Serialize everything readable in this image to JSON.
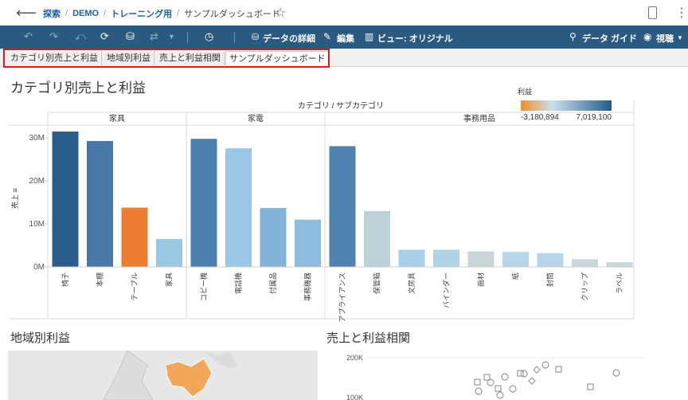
{
  "nav": {
    "back_icon": "arrow-left-icon",
    "breadcrumb": [
      "探索",
      "DEMO",
      "トレーニング用"
    ],
    "current": "サンプルダッシュボード",
    "separator": "/"
  },
  "toolbar": {
    "data_details": "データの詳細",
    "edit": "編集",
    "view": "ビュー: オリジナル",
    "data_guide": "データ ガイド",
    "watch": "視聴"
  },
  "tabs": [
    {
      "label": "カテゴリ別売上と利益",
      "active": false
    },
    {
      "label": "地域別利益",
      "active": false
    },
    {
      "label": "売上と利益相関",
      "active": false
    },
    {
      "label": "サンプルダッシュボード",
      "active": true
    }
  ],
  "sections": {
    "map_title": "地域別利益",
    "scatter_title": "売上と利益相関",
    "scatter_ticks": [
      "200K",
      "100K"
    ]
  },
  "chart_data": {
    "type": "bar",
    "title": "カテゴリ別売上と利益",
    "header": "カテゴリ / サブカテゴリ",
    "ylabel": "売上 ≡",
    "yticks": [
      "0M",
      "10M",
      "20M",
      "30M"
    ],
    "ylim": [
      0,
      33
    ],
    "legend": {
      "title": "利益",
      "min_label": "-3,180,894",
      "max_label": "7,019,100",
      "min_color": "#f28e2b",
      "mid_color": "#c9dfee",
      "max_color": "#255c8a"
    },
    "groups": [
      {
        "name": "家具",
        "items": [
          {
            "label": "椅子",
            "value": 31.5,
            "color": "#2b5e8c"
          },
          {
            "label": "本棚",
            "value": 29.3,
            "color": "#4878a8"
          },
          {
            "label": "テーブル",
            "value": 13.8,
            "color": "#ed7d31"
          },
          {
            "label": "家具",
            "value": 6.5,
            "color": "#9cc7e3"
          }
        ]
      },
      {
        "name": "家電",
        "items": [
          {
            "label": "コピー機",
            "value": 29.8,
            "color": "#4b7fae"
          },
          {
            "label": "電話機",
            "value": 27.6,
            "color": "#9ac7e6"
          },
          {
            "label": "付属品",
            "value": 13.7,
            "color": "#82b4d8"
          },
          {
            "label": "事務機器",
            "value": 11.0,
            "color": "#8dbcde"
          }
        ]
      },
      {
        "name": "事務用品",
        "items": [
          {
            "label": "アプライアンス",
            "value": 28.1,
            "color": "#4f82b0"
          },
          {
            "label": "保管箱",
            "value": 13.0,
            "color": "#bdd2d8"
          },
          {
            "label": "文房具",
            "value": 4.0,
            "color": "#a8d0ea"
          },
          {
            "label": "バインダー",
            "value": 4.0,
            "color": "#b2d3e6"
          },
          {
            "label": "画材",
            "value": 3.6,
            "color": "#c9d6d9"
          },
          {
            "label": "紙",
            "value": 3.5,
            "color": "#b7d6ea"
          },
          {
            "label": "封筒",
            "value": 3.2,
            "color": "#b8d6ea"
          },
          {
            "label": "クリップ",
            "value": 1.8,
            "color": "#c8d7da"
          },
          {
            "label": "ラベル",
            "value": 1.1,
            "color": "#cad8dc"
          }
        ]
      }
    ]
  }
}
